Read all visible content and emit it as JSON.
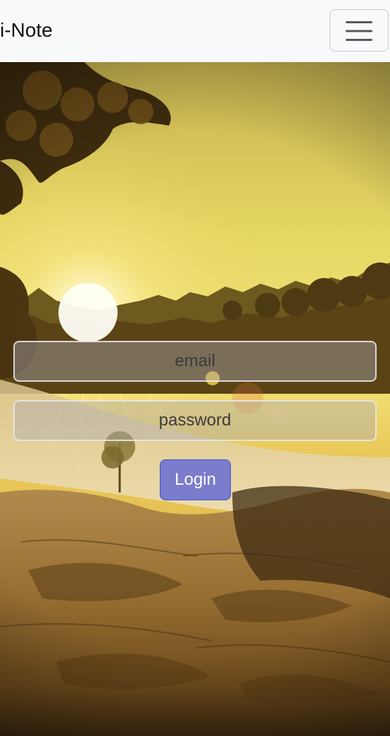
{
  "navbar": {
    "brand": "i-Note",
    "toggler_icon": "hamburger-menu-icon"
  },
  "login_form": {
    "email_placeholder": "email",
    "password_placeholder": "password",
    "submit_label": "Login"
  },
  "colors": {
    "navbar_bg": "#f8f9fa",
    "button_bg": "#7b7ccc",
    "button_border": "#3a55d8",
    "input_bg": "rgba(170,170,180,0.42)"
  }
}
